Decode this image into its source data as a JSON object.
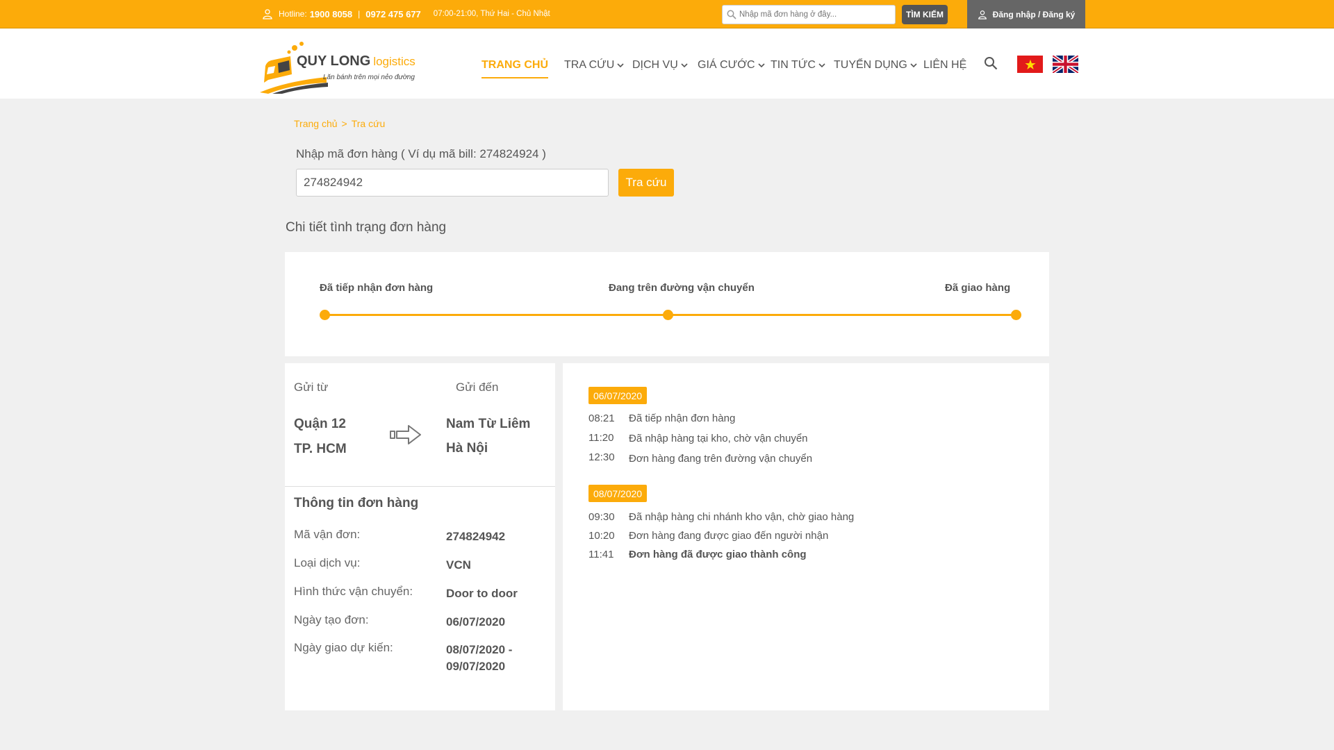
{
  "topbar": {
    "hotline_label": "Hotline:",
    "hotline_1": "1900 8058",
    "separator": "|",
    "hotline_2": "0972 475 677",
    "hours": "07:00-21:00, Thứ Hai - Chủ Nhật",
    "search_placeholder": "Nhập mã đơn hàng ở đây...",
    "search_button": "TÌM KIẾM",
    "login_label": "Đăng nhập / Đăng ký"
  },
  "logo": {
    "title": "QUY LONG",
    "subtitle": "logistics",
    "slogan": "Lăn bánh trên mọi nẻo đường"
  },
  "nav": {
    "items": [
      {
        "label": "TRANG CHỦ",
        "active": true,
        "dropdown": false
      },
      {
        "label": "TRA CỨU",
        "active": false,
        "dropdown": true
      },
      {
        "label": "DỊCH VỤ",
        "active": false,
        "dropdown": true
      },
      {
        "label": "GIÁ CƯỚC",
        "active": false,
        "dropdown": true
      },
      {
        "label": "TIN TỨC",
        "active": false,
        "dropdown": true
      },
      {
        "label": "TUYỂN DỤNG",
        "active": false,
        "dropdown": true
      },
      {
        "label": "LIÊN HỆ",
        "active": false,
        "dropdown": false
      }
    ]
  },
  "breadcrumb": {
    "home": "Trang chủ",
    "separator": ">",
    "current": "Tra cứu"
  },
  "tracking": {
    "label": "Nhập mã đơn hàng ( Ví dụ mã bill: 274824924 )",
    "input_value": "274824942",
    "button": "Tra cứu"
  },
  "status": {
    "section_title": "Chi tiết tình trạng đơn hàng",
    "steps": [
      "Đã tiếp nhận đơn hàng",
      "Đang trên đường vận chuyển",
      "Đã giao hàng"
    ],
    "progress_percent": 100
  },
  "route": {
    "from_label": "Gửi từ",
    "to_label": "Gửi đến",
    "from_district": "Quận 12",
    "from_city": "TP. HCM",
    "to_district": "Nam Từ Liêm",
    "to_city": "Hà Nội"
  },
  "order_info": {
    "title": "Thông tin đơn hàng",
    "rows": [
      {
        "label": "Mã vận đơn:",
        "value": "274824942"
      },
      {
        "label": "Loại dịch vụ:",
        "value": "VCN"
      },
      {
        "label": "Hình thức vận chuyển:",
        "value": "Door to door"
      },
      {
        "label": "Ngày tạo đơn:",
        "value": "06/07/2020"
      },
      {
        "label": "Ngày giao dự kiến:",
        "value": "08/07/2020 - 09/07/2020"
      }
    ]
  },
  "timeline": [
    {
      "date": "06/07/2020",
      "events": [
        {
          "time": "08:21",
          "text": "Đã tiếp nhận đơn hàng"
        },
        {
          "time": "11:20",
          "text": "Đã nhập hàng tại kho, chờ vận chuyển"
        },
        {
          "time": "12:30",
          "text": "Đơn hàng đang trên đường vận chuyển"
        }
      ]
    },
    {
      "date": "08/07/2020",
      "events": [
        {
          "time": "09:30",
          "text": "Đã nhập hàng chi nhánh kho vận, chờ giao hàng"
        },
        {
          "time": "10:20",
          "text": "Đơn hàng đang được giao đến người nhận"
        },
        {
          "time": "11:41",
          "text": "Đơn hàng đã được giao thành công"
        }
      ]
    }
  ],
  "colors": {
    "accent": "#fcab0a",
    "dark_button": "#555555",
    "login_bg": "#666666",
    "page_bg": "#f0f0f0"
  },
  "icons": {
    "hotline": "person-icon",
    "search": "search-icon",
    "login": "user-icon",
    "route": "arrow-right-icon",
    "nav_dropdown": "chevron-down-icon",
    "flags": [
      "vietnam-flag-icon",
      "uk-flag-icon"
    ]
  }
}
